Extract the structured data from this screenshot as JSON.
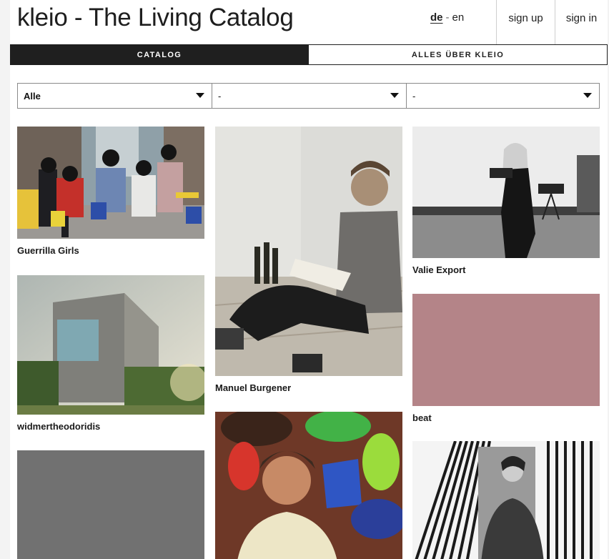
{
  "header": {
    "title": "kleio - The Living Catalog",
    "lang_de": "de",
    "lang_sep": "-",
    "lang_en": "en",
    "signup": "sign up",
    "signin": "sign in"
  },
  "nav": {
    "tabs": [
      {
        "label": "CATALOG"
      },
      {
        "label": "ALLES ÜBER KLEIO"
      }
    ]
  },
  "filters": [
    {
      "value": "Alle"
    },
    {
      "value": "-"
    },
    {
      "value": "-"
    }
  ],
  "cards": [
    {
      "label": "Guerrilla Girls"
    },
    {
      "label": "widmertheodoridis"
    },
    {
      "label": ""
    },
    {
      "label": "Manuel Burgener"
    },
    {
      "label": ""
    },
    {
      "label": "Valie Export"
    },
    {
      "label": "beat"
    },
    {
      "label": ""
    }
  ],
  "colors": {
    "nav_active": "#1f1f1f",
    "beat_swatch": "#b48488",
    "grey_swatch": "#717171"
  }
}
